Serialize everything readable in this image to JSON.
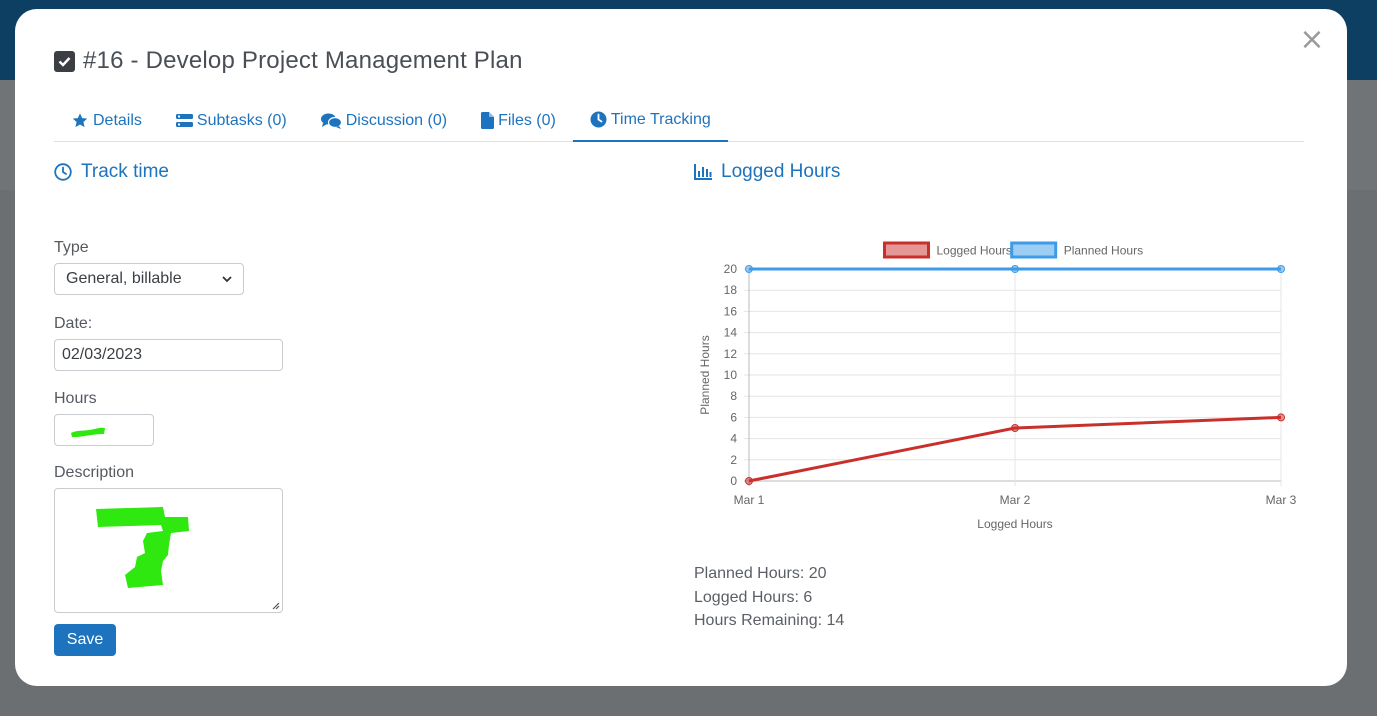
{
  "modal": {
    "title": "#16 - Develop Project Management Plan",
    "close_label": "×"
  },
  "tabs": [
    {
      "label": "Details",
      "icon": "star-icon"
    },
    {
      "label": "Subtasks (0)",
      "icon": "tasks-icon"
    },
    {
      "label": "Discussion (0)",
      "icon": "comments-icon"
    },
    {
      "label": "Files (0)",
      "icon": "file-icon"
    },
    {
      "label": "Time Tracking",
      "icon": "clock-icon",
      "active": true
    }
  ],
  "track_time": {
    "heading": "Track time",
    "type_label": "Type",
    "type_value": "General, billable",
    "date_label": "Date:",
    "date_value": "02/03/2023",
    "hours_label": "Hours",
    "description_label": "Description",
    "save_label": "Save"
  },
  "logged_hours": {
    "heading": "Logged Hours",
    "summary": {
      "planned": "Planned Hours: 20",
      "logged": "Logged Hours: 6",
      "remaining": "Hours Remaining: 14"
    }
  },
  "colors": {
    "accent": "#1e73be",
    "logged_series": "#c9302c",
    "planned_series": "#3d9be9",
    "redaction": "#2ee80f"
  },
  "chart_data": {
    "type": "line",
    "categories": [
      "Mar 1",
      "Mar 2",
      "Mar 3"
    ],
    "series": [
      {
        "name": "Logged Hours",
        "values": [
          0,
          5,
          6
        ],
        "color": "#c9302c"
      },
      {
        "name": "Planned Hours",
        "values": [
          20,
          20,
          20
        ],
        "color": "#3d9be9"
      }
    ],
    "xlabel": "Logged Hours",
    "ylabel": "Planned Hours",
    "ylim": [
      0,
      20
    ],
    "yticks": [
      "0",
      "2",
      "4",
      "6",
      "8",
      "10",
      "12",
      "14",
      "16",
      "18",
      "20"
    ],
    "grid": true,
    "legend": "top-center"
  }
}
